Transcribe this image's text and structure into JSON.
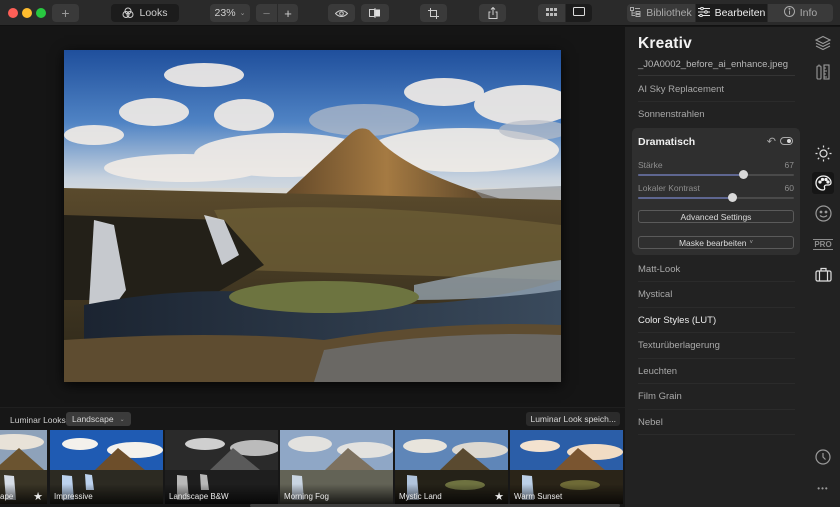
{
  "window": {
    "traffic_lights": [
      "close",
      "minimize",
      "zoom"
    ]
  },
  "toolbar": {
    "add_label": "+",
    "looks_label": "Looks",
    "zoom_value": "23%",
    "zoom_out_label": "−",
    "zoom_in_label": "+",
    "icons": {
      "looks": "looks-icon",
      "preview": "eye-icon",
      "compare": "compare-icon",
      "crop": "crop-icon",
      "share": "share-icon",
      "grid_view": "grid-icon",
      "single_view": "single-view-icon"
    },
    "modes": [
      {
        "label": "Bibliothek",
        "icon": "library-icon",
        "active": false
      },
      {
        "label": "Bearbeiten",
        "icon": "sliders-icon",
        "active": true
      },
      {
        "label": "Info",
        "icon": "info-icon",
        "active": false
      }
    ]
  },
  "panel": {
    "title": "Kreativ",
    "file_name": "_J0A0002_before_ai_enhance.jpeg",
    "tools_before": [
      "AI Sky Replacement",
      "Sonnenstrahlen"
    ],
    "active_tool": {
      "title": "Dramatisch",
      "reset_icon": "undo-icon",
      "toggle_icon": "visibility-toggle-icon",
      "sliders": [
        {
          "label": "Stärke",
          "value": 67,
          "fraction": 0.67
        },
        {
          "label": "Lokaler Kontrast",
          "value": 60,
          "fraction": 0.6
        }
      ],
      "advanced_label": "Advanced Settings",
      "mask_label": "Maske bearbeiten",
      "mask_chevron": "˅"
    },
    "tools_after": [
      {
        "label": "Matt-Look",
        "highlight": false
      },
      {
        "label": "Mystical",
        "highlight": false
      },
      {
        "label": "Color Styles (LUT)",
        "highlight": true
      },
      {
        "label": "Texturüberlagerung",
        "highlight": false
      },
      {
        "label": "Leuchten",
        "highlight": false
      },
      {
        "label": "Film Grain",
        "highlight": false
      },
      {
        "label": "Nebel",
        "highlight": false
      }
    ]
  },
  "rail": {
    "icons": [
      "layers-icon",
      "canvas-icon",
      "essentials-icon",
      "creative-icon",
      "portrait-icon",
      "pro-icon",
      "professional-icon",
      "history-icon",
      "more-icon"
    ],
    "pro_label": "PRO",
    "more_label": "•••"
  },
  "looks": {
    "label": "Luminar Looks:",
    "category": "Landscape",
    "save_label": "Luminar Look speich...",
    "items": [
      {
        "name": "ape",
        "starred": true,
        "style": "natural"
      },
      {
        "name": "Impressive",
        "starred": false,
        "style": "vivid"
      },
      {
        "name": "Landscape B&W",
        "starred": false,
        "style": "bw"
      },
      {
        "name": "Morning Fog",
        "starred": false,
        "style": "fog"
      },
      {
        "name": "Mystic Land",
        "starred": true,
        "style": "mystic"
      },
      {
        "name": "Warm Sunset",
        "starred": false,
        "style": "warm"
      }
    ],
    "star_glyph": "★"
  },
  "colors": {
    "accent_slider": "#5e6690",
    "panel_bg": "#222222",
    "card_bg": "#2f2f2f"
  }
}
